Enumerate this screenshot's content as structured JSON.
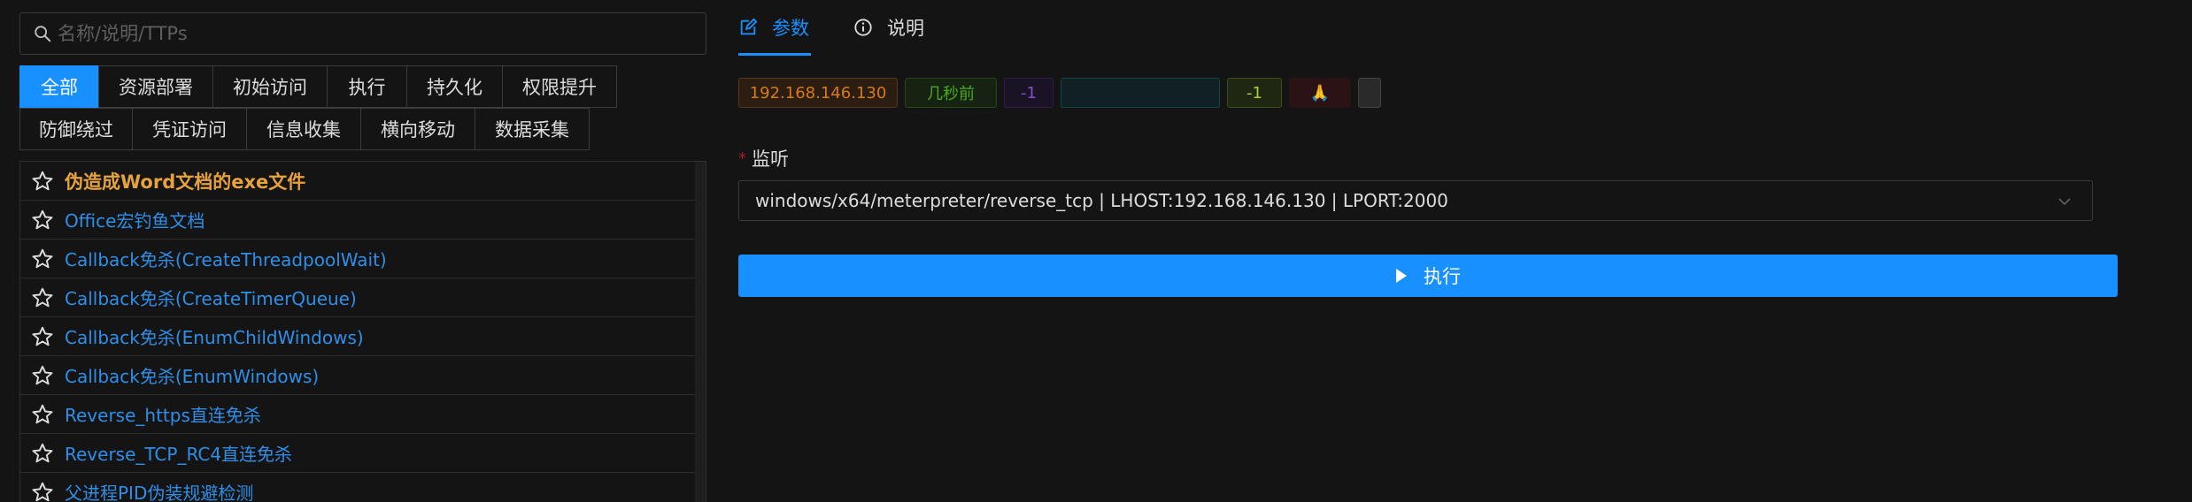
{
  "search": {
    "placeholder": "名称/说明/TTPs",
    "icon": "search-icon"
  },
  "tabs": {
    "row1": [
      "全部",
      "资源部署",
      "初始访问",
      "执行",
      "持久化",
      "权限提升"
    ],
    "row2": [
      "防御绕过",
      "凭证访问",
      "信息收集",
      "横向移动",
      "数据采集"
    ],
    "active": "全部"
  },
  "list": [
    {
      "label": "伪造成Word文档的exe文件",
      "featured": true
    },
    {
      "label": "Office宏钓鱼文档"
    },
    {
      "label": "Callback免杀(CreateThreadpoolWait)"
    },
    {
      "label": "Callback免杀(CreateTimerQueue)"
    },
    {
      "label": "Callback免杀(EnumChildWindows)"
    },
    {
      "label": "Callback免杀(EnumWindows)"
    },
    {
      "label": "Reverse_https直连免杀"
    },
    {
      "label": "Reverse_TCP_RC4直连免杀"
    },
    {
      "label": "父进程PID伪装规避检测"
    }
  ],
  "right_tabs": {
    "params": "参数",
    "desc": "说明",
    "active": "参数"
  },
  "session_tags": [
    {
      "text": "192.168.146.130",
      "color": "#d87a16",
      "bg": "#2b1d11",
      "border": "#593815"
    },
    {
      "text": "几秒前",
      "color": "#49aa19",
      "bg": "#162312",
      "border": "#274916"
    },
    {
      "text": "-1",
      "color": "#854eca",
      "bg": "#1a1325",
      "border": "#301c4d"
    },
    {
      "text": "",
      "color": "#13a8a8",
      "bg": "#112123",
      "border": "#144848"
    },
    {
      "text": "-1",
      "color": "#a9d134",
      "bg": "#1f2611",
      "border": "#3e4f13"
    },
    {
      "text": "🙏",
      "color": "#d32029",
      "bg": "#2a1215",
      "border": "#2a1215"
    },
    {
      "text": "",
      "color": "#ffffff",
      "bg": "#2a2a2a",
      "border": "#434343"
    }
  ],
  "form": {
    "required_mark": "*",
    "listen_label": "监听",
    "listen_value": "windows/x64/meterpreter/reverse_tcp | LHOST:192.168.146.130 | LPORT:2000"
  },
  "exec_button": "执行",
  "colors": {
    "primary": "#1890ff",
    "featured": "#e6a23c",
    "link": "#2f8ee8"
  }
}
